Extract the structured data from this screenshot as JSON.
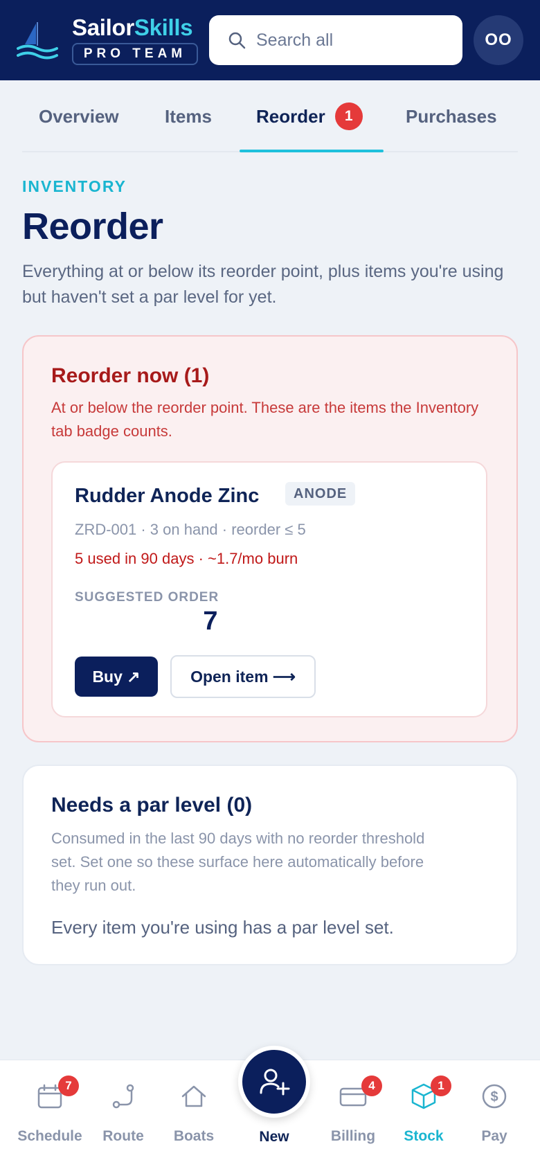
{
  "header": {
    "brand_part1": "Sailor",
    "brand_part2": "Skills",
    "brand_subtitle": "PRO TEAM",
    "search_placeholder": "Search all",
    "avatar_initials": "OO"
  },
  "tabs": [
    {
      "label": "Overview",
      "active": false
    },
    {
      "label": "Items",
      "active": false
    },
    {
      "label": "Reorder",
      "active": true,
      "badge": "1"
    },
    {
      "label": "Purchases",
      "active": false
    }
  ],
  "page": {
    "eyebrow": "INVENTORY",
    "title": "Reorder",
    "description": "Everything at or below its reorder point, plus items you're using but haven't set a par level for yet."
  },
  "reorder_now": {
    "title": "Reorder now (1)",
    "description": "At or below the reorder point. These are the items the Inventory tab badge counts.",
    "items": [
      {
        "name": "Rudder Anode Zinc",
        "tag": "ANODE",
        "meta": "ZRD-001 · 3 on hand · reorder ≤ 5",
        "usage": "5 used in 90 days · ~1.7/mo burn",
        "suggested_label": "SUGGESTED ORDER",
        "suggested_value": "7",
        "buy_label": "Buy ↗",
        "open_label": "Open item ⟶"
      }
    ]
  },
  "par_level": {
    "title": "Needs a par level (0)",
    "description": "Consumed in the last 90 days with no reorder threshold set. Set one so these surface here automatically before they run out.",
    "empty_text": "Every item you're using has a par level set."
  },
  "bottom_nav": [
    {
      "label": "Schedule",
      "icon": "calendar-icon",
      "badge": "7",
      "active": false
    },
    {
      "label": "Route",
      "icon": "route-icon",
      "active": false
    },
    {
      "label": "Boats",
      "icon": "home-icon",
      "active": false
    },
    {
      "label": "New",
      "icon": "add-user-icon",
      "active": false
    },
    {
      "label": "Billing",
      "icon": "card-icon",
      "badge": "4",
      "active": false
    },
    {
      "label": "Stock",
      "icon": "box-icon",
      "badge": "1",
      "active": true
    },
    {
      "label": "Pay",
      "icon": "dollar-icon",
      "active": false
    }
  ],
  "colors": {
    "navy": "#0b1f5c",
    "accent": "#1ab5d0",
    "danger": "#e53a3a"
  }
}
